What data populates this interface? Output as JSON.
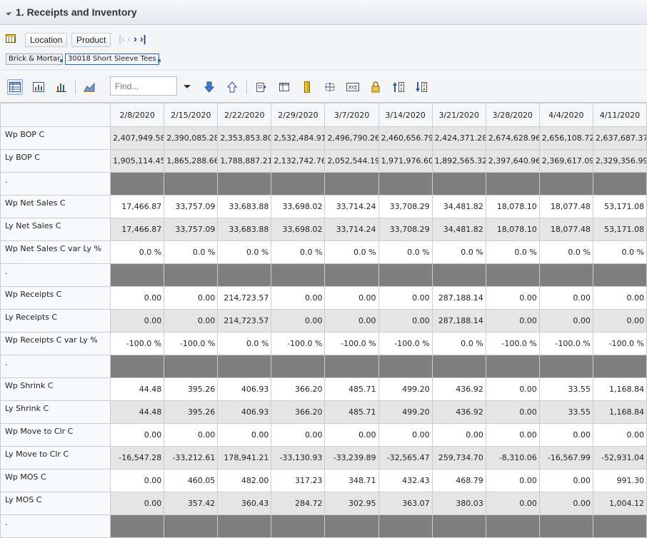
{
  "panel": {
    "title": "1. Receipts and Inventory"
  },
  "location_bar": {
    "location_label": "Location",
    "product_label": "Product",
    "breadcrumbs": [
      "Brick & Mortar",
      "30018 Short Sleeve Tees"
    ]
  },
  "toolbar": {
    "find_placeholder": "Find...",
    "find_value": "Find..."
  },
  "grid": {
    "columns": [
      "2/8/2020",
      "2/15/2020",
      "2/22/2020",
      "2/29/2020",
      "3/7/2020",
      "3/14/2020",
      "3/21/2020",
      "3/28/2020",
      "4/4/2020",
      "4/11/2020"
    ],
    "rows": [
      {
        "label": "Wp BOP C",
        "style": "grey",
        "values": [
          "2,407,949.58",
          "2,390,085.28",
          "2,353,853.80",
          "2,532,484.91",
          "2,496,790.26",
          "2,460,656.79",
          "2,424,371.28",
          "2,674,628.96",
          "2,656,108.72",
          "2,637,687.37"
        ]
      },
      {
        "label": "Ly BOP C",
        "style": "grey",
        "values": [
          "1,905,114.45",
          "1,865,288.66",
          "1,788,887.21",
          "2,132,742.76",
          "2,052,544.19",
          "1,971,976.60",
          "1,892,565.32",
          "2,397,640.96",
          "2,369,617.09",
          "2,329,356.99"
        ]
      },
      {
        "label": ".",
        "style": "spacer",
        "values": [
          "",
          "",
          "",
          "",
          "",
          "",
          "",
          "",
          "",
          ""
        ]
      },
      {
        "label": "Wp Net Sales C",
        "style": "white",
        "values": [
          "17,466.87",
          "33,757.09",
          "33,683.88",
          "33,698.02",
          "33,714.24",
          "33,708.29",
          "34,481.82",
          "18,078.10",
          "18,077.48",
          "53,171.08"
        ]
      },
      {
        "label": "Ly Net Sales C",
        "style": "grey",
        "values": [
          "17,466.87",
          "33,757.09",
          "33,683.88",
          "33,698.02",
          "33,714.24",
          "33,708.29",
          "34,481.82",
          "18,078.10",
          "18,077.48",
          "53,171.08"
        ]
      },
      {
        "label": "Wp Net Sales C var Ly %",
        "style": "white",
        "values": [
          "0.0 %",
          "0.0 %",
          "0.0 %",
          "0.0 %",
          "0.0 %",
          "0.0 %",
          "0.0 %",
          "0.0 %",
          "0.0 %",
          "0.0 %"
        ]
      },
      {
        "label": ".",
        "style": "spacer",
        "values": [
          "",
          "",
          "",
          "",
          "",
          "",
          "",
          "",
          "",
          ""
        ]
      },
      {
        "label": "Wp Receipts C",
        "style": "white",
        "values": [
          "0.00",
          "0.00",
          "214,723.57",
          "0.00",
          "0.00",
          "0.00",
          "287,188.14",
          "0.00",
          "0.00",
          "0.00"
        ]
      },
      {
        "label": "Ly Receipts C",
        "style": "grey",
        "values": [
          "0.00",
          "0.00",
          "214,723.57",
          "0.00",
          "0.00",
          "0.00",
          "287,188.14",
          "0.00",
          "0.00",
          "0.00"
        ]
      },
      {
        "label": "Wp Receipts C var Ly %",
        "style": "white",
        "values": [
          "-100.0 %",
          "-100.0 %",
          "0.0 %",
          "-100.0 %",
          "-100.0 %",
          "-100.0 %",
          "0.0 %",
          "-100.0 %",
          "-100.0 %",
          "-100.0 %"
        ]
      },
      {
        "label": ".",
        "style": "spacer",
        "values": [
          "",
          "",
          "",
          "",
          "",
          "",
          "",
          "",
          "",
          ""
        ]
      },
      {
        "label": "Wp Shrink C",
        "style": "white",
        "values": [
          "44.48",
          "395.26",
          "406.93",
          "366.20",
          "485.71",
          "499.20",
          "436.92",
          "0.00",
          "33.55",
          "1,168.84"
        ]
      },
      {
        "label": "Ly Shrink C",
        "style": "grey",
        "values": [
          "44.48",
          "395.26",
          "406.93",
          "366.20",
          "485.71",
          "499.20",
          "436.92",
          "0.00",
          "33.55",
          "1,168.84"
        ]
      },
      {
        "label": "Wp Move to Clr C",
        "style": "white",
        "values": [
          "0.00",
          "0.00",
          "0.00",
          "0.00",
          "0.00",
          "0.00",
          "0.00",
          "0.00",
          "0.00",
          "0.00"
        ]
      },
      {
        "label": "Ly Move to Clr C",
        "style": "grey",
        "values": [
          "-16,547.28",
          "-33,212.61",
          "178,941.21",
          "-33,130.93",
          "-33,239.89",
          "-32,565.47",
          "259,734.70",
          "-8,310.06",
          "-16,567.99",
          "-52,931.04"
        ]
      },
      {
        "label": "Wp MOS C",
        "style": "white",
        "values": [
          "0.00",
          "460.05",
          "482.00",
          "317.23",
          "348.71",
          "432.43",
          "468.79",
          "0.00",
          "0.00",
          "991.30"
        ]
      },
      {
        "label": "Ly MOS C",
        "style": "grey",
        "values": [
          "0.00",
          "357.42",
          "360.43",
          "284.72",
          "302.95",
          "363.07",
          "380.03",
          "0.00",
          "0.00",
          "1,004.12"
        ]
      },
      {
        "label": ".",
        "style": "spacer",
        "values": [
          "",
          "",
          "",
          "",
          "",
          "",
          "",
          "",
          "",
          ""
        ]
      }
    ]
  }
}
